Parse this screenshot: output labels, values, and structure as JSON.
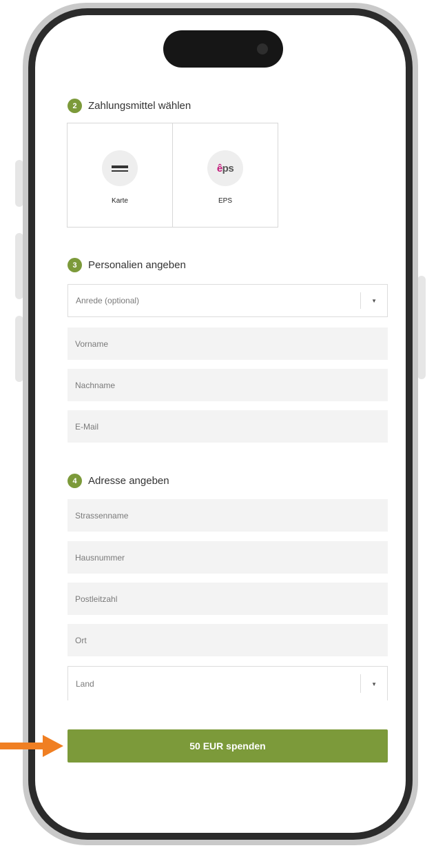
{
  "payment": {
    "step": "2",
    "title": "Zahlungsmittel wählen",
    "methods": [
      {
        "label": "Karte",
        "icon": "credit-card-icon"
      },
      {
        "label": "EPS",
        "icon": "eps-logo-icon",
        "logo_text_e": "ê",
        "logo_text_rest": "ps"
      }
    ]
  },
  "personal": {
    "step": "3",
    "title": "Personalien angeben",
    "salutation": {
      "placeholder": "Anrede (optional)"
    },
    "first_name": {
      "placeholder": "Vorname"
    },
    "last_name": {
      "placeholder": "Nachname"
    },
    "email": {
      "placeholder": "E-Mail"
    }
  },
  "address": {
    "step": "4",
    "title": "Adresse angeben",
    "street": {
      "placeholder": "Strassenname"
    },
    "house_number": {
      "placeholder": "Hausnummer"
    },
    "postal_code": {
      "placeholder": "Postleitzahl"
    },
    "city": {
      "placeholder": "Ort"
    },
    "country": {
      "placeholder": "Land"
    }
  },
  "submit": {
    "label": "50 EUR spenden"
  },
  "colors": {
    "accent": "#7c9a3a",
    "arrow": "#f07f22",
    "eps_brand": "#c2197a"
  }
}
